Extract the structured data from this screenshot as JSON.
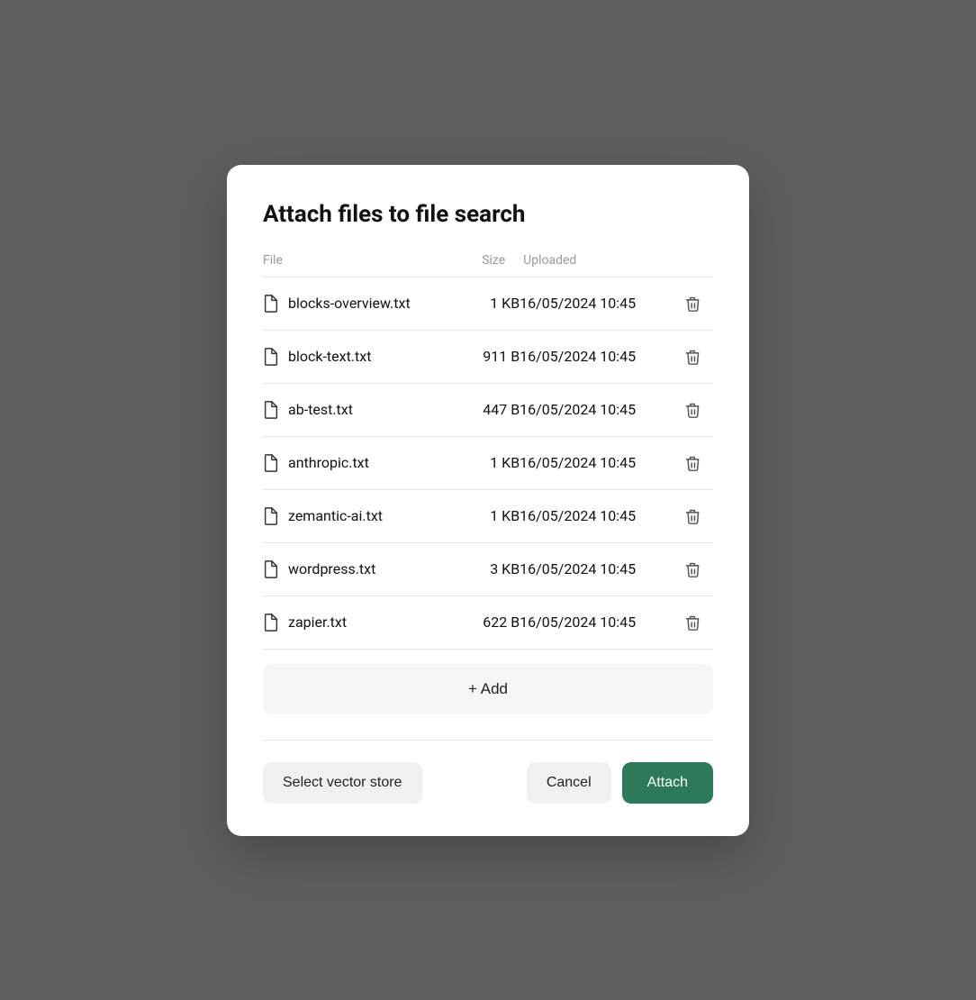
{
  "modal": {
    "title": "Attach files to file search",
    "columns": {
      "file": "File",
      "size": "Size",
      "uploaded": "Uploaded"
    },
    "files": [
      {
        "name": "blocks-overview.txt",
        "size": "1 KB",
        "uploaded": "16/05/2024 10:45"
      },
      {
        "name": "block-text.txt",
        "size": "911 B",
        "uploaded": "16/05/2024 10:45"
      },
      {
        "name": "ab-test.txt",
        "size": "447 B",
        "uploaded": "16/05/2024 10:45"
      },
      {
        "name": "anthropic.txt",
        "size": "1 KB",
        "uploaded": "16/05/2024 10:45"
      },
      {
        "name": "zemantic-ai.txt",
        "size": "1 KB",
        "uploaded": "16/05/2024 10:45"
      },
      {
        "name": "wordpress.txt",
        "size": "3 KB",
        "uploaded": "16/05/2024 10:45"
      },
      {
        "name": "zapier.txt",
        "size": "622 B",
        "uploaded": "16/05/2024 10:45"
      }
    ],
    "add_button_label": "+ Add",
    "select_vector_store_label": "Select vector store",
    "cancel_label": "Cancel",
    "attach_label": "Attach"
  }
}
